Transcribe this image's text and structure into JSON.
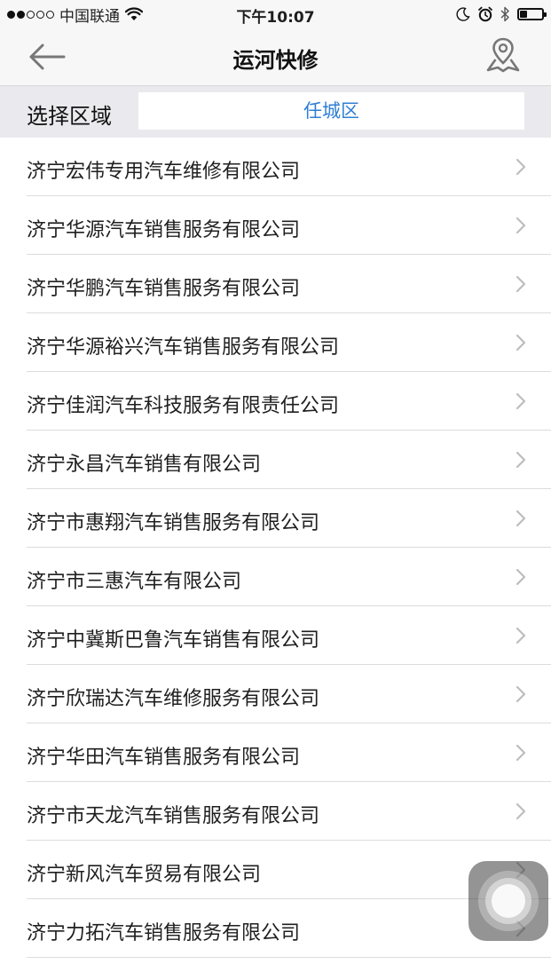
{
  "status_bar": {
    "carrier": "中国联通",
    "time": "下午10:07",
    "signal_filled": 2,
    "signal_total": 5,
    "battery_level_percent": 35
  },
  "nav": {
    "title": "运河快修",
    "back_icon": "arrow-left-icon",
    "map_icon": "map-pin-icon"
  },
  "region": {
    "label": "选择区域",
    "selected": "任城区"
  },
  "colors": {
    "accent": "#2f7fd4",
    "bar_background": "#f7f7f7",
    "region_background": "#e9e9ee",
    "separator": "#dcdcdc"
  },
  "companies": [
    {
      "name": "济宁宏伟专用汽车维修有限公司"
    },
    {
      "name": "济宁华源汽车销售服务有限公司"
    },
    {
      "name": "济宁华鹏汽车销售服务有限公司"
    },
    {
      "name": "济宁华源裕兴汽车销售服务有限公司"
    },
    {
      "name": "济宁佳润汽车科技服务有限责任公司"
    },
    {
      "name": "济宁永昌汽车销售有限公司"
    },
    {
      "name": "济宁市惠翔汽车销售服务有限公司"
    },
    {
      "name": "济宁市三惠汽车有限公司"
    },
    {
      "name": "济宁中冀斯巴鲁汽车销售有限公司"
    },
    {
      "name": "济宁欣瑞达汽车维修服务有限公司"
    },
    {
      "name": "济宁华田汽车销售服务有限公司"
    },
    {
      "name": "济宁市天龙汽车销售服务有限公司"
    },
    {
      "name": "济宁新风汽车贸易有限公司"
    },
    {
      "name": "济宁力拓汽车销售服务有限公司"
    }
  ]
}
